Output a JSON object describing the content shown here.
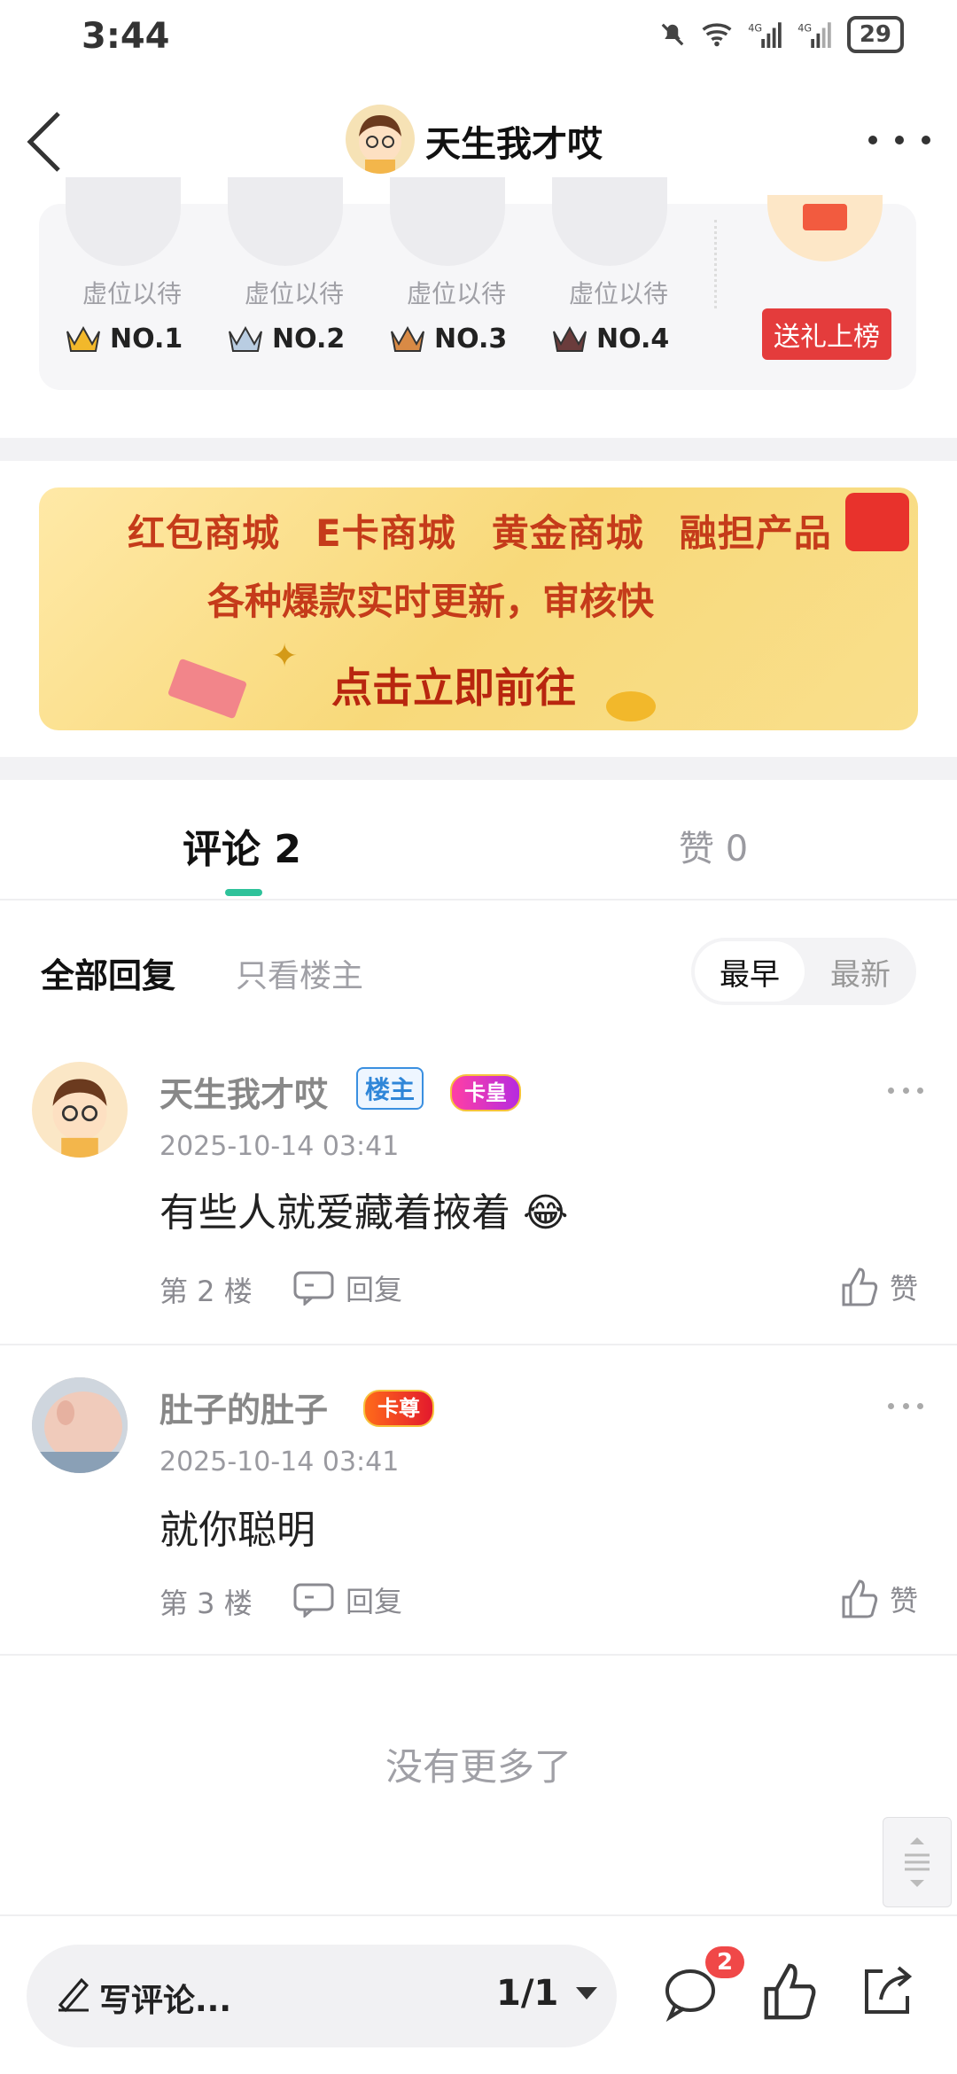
{
  "status_bar": {
    "time": "3:44",
    "battery": "29"
  },
  "header": {
    "title": "天生我才哎"
  },
  "rank": {
    "slots": [
      {
        "label": "虚位以待",
        "no": "NO.1",
        "crown_color": "#f2b82b"
      },
      {
        "label": "虚位以待",
        "no": "NO.2",
        "crown_color": "#8aa7c6"
      },
      {
        "label": "虚位以待",
        "no": "NO.3",
        "crown_color": "#d98a45"
      },
      {
        "label": "虚位以待",
        "no": "NO.4",
        "crown_color": "#6b3c3c"
      }
    ],
    "gift_button": "送礼上榜"
  },
  "banner": {
    "items": [
      "红包商城",
      "E卡商城",
      "黄金商城",
      "融担产品"
    ],
    "line2": "各种爆款实时更新，审核快",
    "cta": "点击立即前往"
  },
  "tabs": {
    "comments": "评论 2",
    "likes": "赞 0"
  },
  "filters": {
    "all": "全部回复",
    "owner_only": "只看楼主",
    "sort_early": "最早",
    "sort_new": "最新"
  },
  "comments": [
    {
      "name": "天生我才哎",
      "owner_badge": "楼主",
      "medal": "卡皇",
      "date": "2025-10-14 03:41",
      "text": "有些人就爱藏着掖着",
      "emoji": "😂",
      "floor": "第 2 楼",
      "reply": "回复",
      "like": "赞"
    },
    {
      "name": "肚子的肚子",
      "medal": "卡尊",
      "date": "2025-10-14 03:41",
      "text": "就你聪明",
      "floor": "第 3 楼",
      "reply": "回复",
      "like": "赞"
    }
  ],
  "no_more": "没有更多了",
  "bottom_bar": {
    "write_placeholder": "写评论...",
    "page_indicator": "1/1",
    "message_count": "2"
  },
  "colors": {
    "accent": "#2ec29a",
    "gift_red": "#e43c3c",
    "badge_blue": "#2f86d8"
  }
}
